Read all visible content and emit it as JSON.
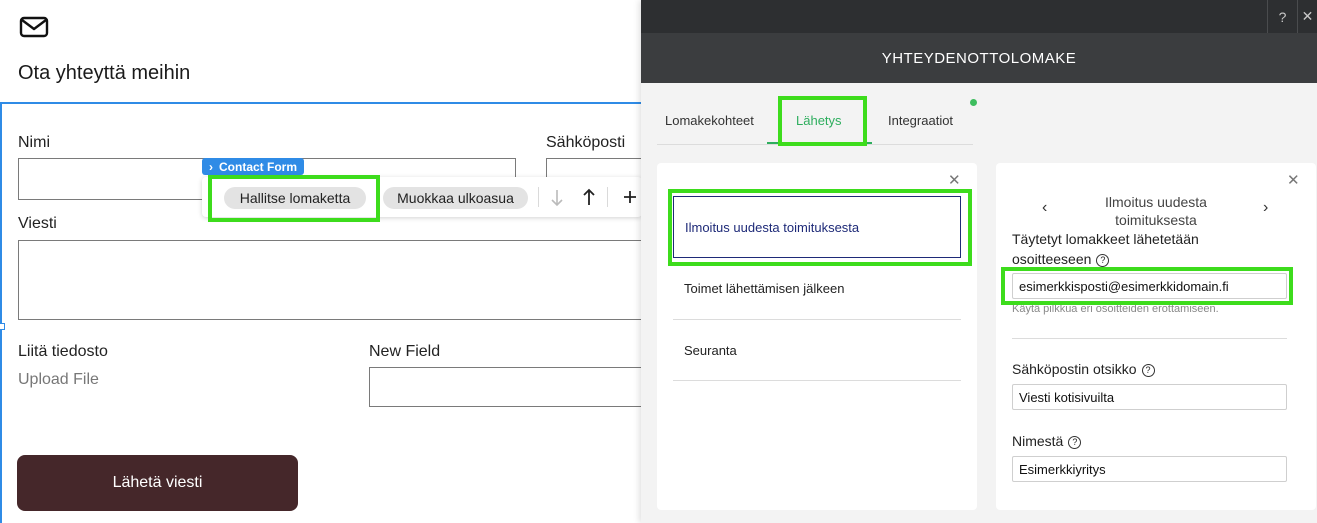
{
  "site": {
    "heading": "Ota yhteyttä meihin",
    "form": {
      "name_label": "Nimi",
      "email_label": "Sähköposti",
      "message_label": "Viesti",
      "attach_label": "Liitä tiedosto",
      "upload_text": "Upload File",
      "new_field_label": "New Field",
      "submit_label": "Lähetä viesti"
    },
    "element_tag": "Contact Form",
    "toolbar": {
      "manage_label": "Hallitse lomaketta",
      "design_label": "Muokkaa ulkoasua"
    }
  },
  "panel": {
    "topbar": {
      "help": "?",
      "close": "✕"
    },
    "title": "YHTEYDENOTTOLOMAKE",
    "tabs": [
      {
        "label": "Lomakekohteet"
      },
      {
        "label": "Lähetys"
      },
      {
        "label": "Integraatiot"
      }
    ],
    "submission_items": [
      {
        "label": "Ilmoitus uudesta toimituksesta"
      },
      {
        "label": "Toimet lähettämisen jälkeen"
      },
      {
        "label": "Seuranta"
      }
    ],
    "detail": {
      "title": "Ilmoitus uudesta toimituksesta",
      "recipients_label": "Täytetyt lomakkeet lähetetään osoitteeseen",
      "recipients_value": "esimerkkisposti@esimerkkidomain.fi",
      "recipients_hint": "Käytä pilkkua eri osoitteiden erottamiseen.",
      "subject_label": "Sähköpostin otsikko",
      "subject_value": "Viesti kotisivuilta",
      "from_label": "Nimestä",
      "from_value": "Esimerkkiyritys"
    }
  },
  "colors": {
    "highlight": "#3ddc1c",
    "accent_green": "#2eae5e",
    "selection_blue": "#2f8be6",
    "submit_button": "#45272a",
    "panel_header": "#3b3d3f"
  },
  "icons": [
    "mail-icon",
    "chevron-right-icon",
    "arrow-down-icon",
    "arrow-up-icon",
    "plus-icon",
    "help-icon",
    "close-icon",
    "chevron-left-icon"
  ]
}
